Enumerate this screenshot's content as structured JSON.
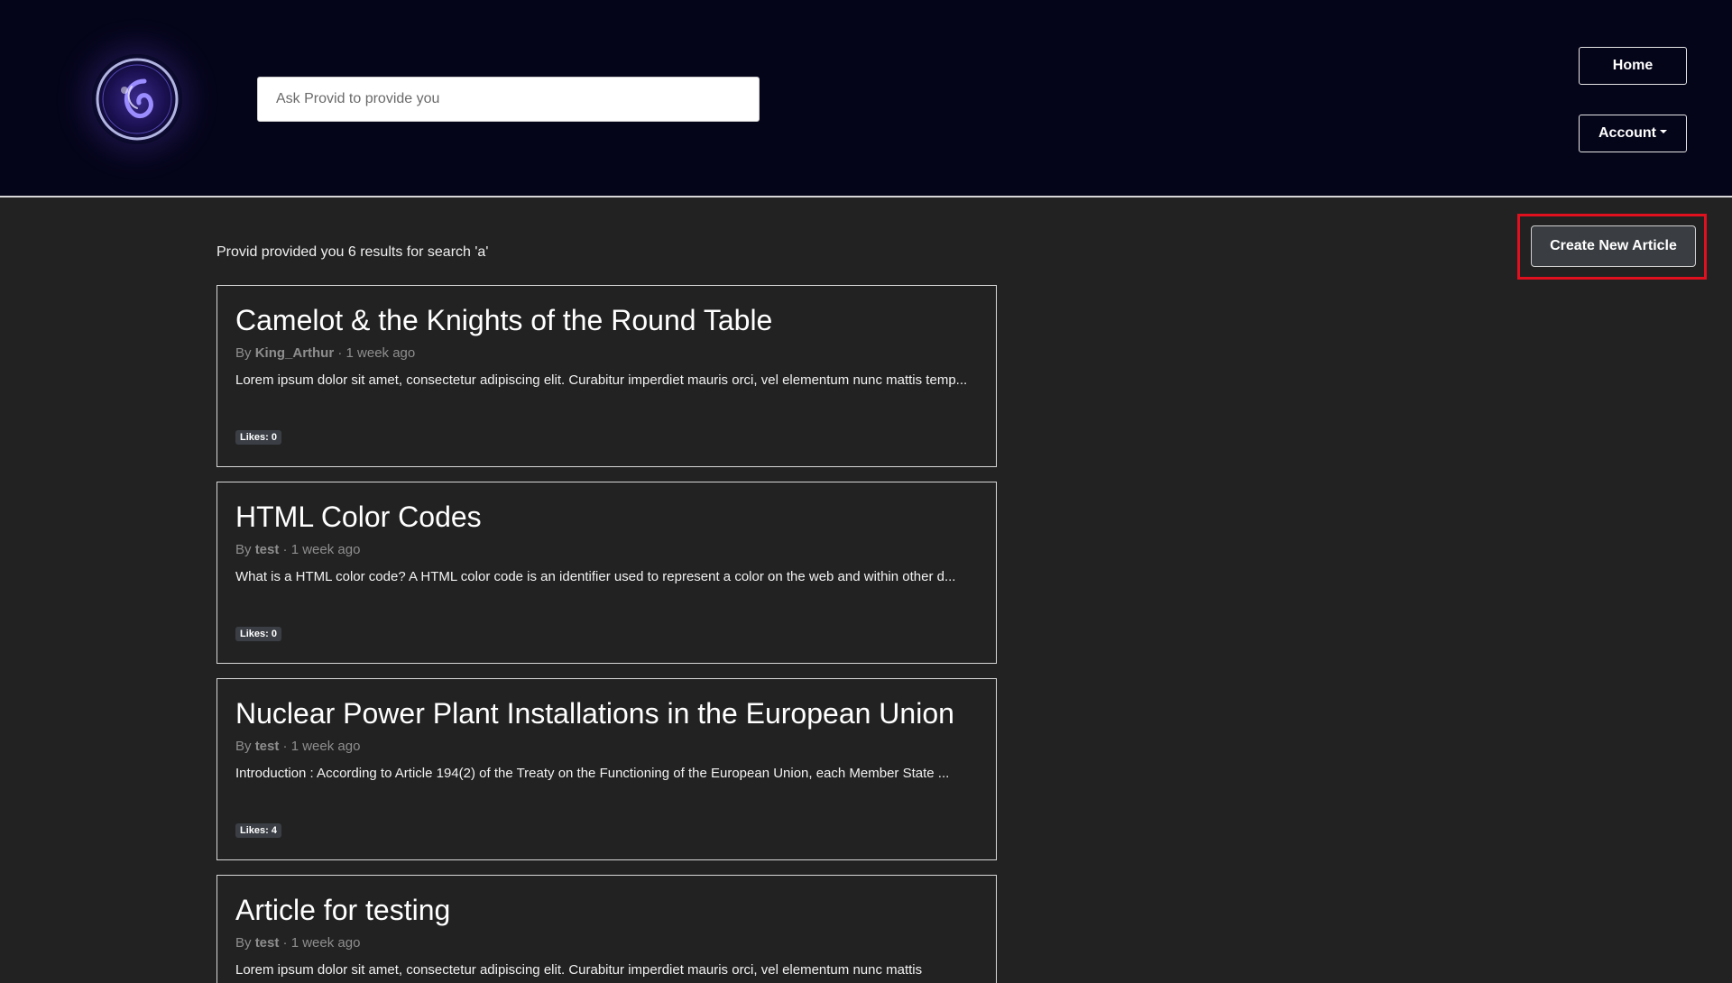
{
  "header": {
    "search_placeholder": "Ask Provid to provide you",
    "nav": {
      "home_label": "Home",
      "account_label": "Account"
    }
  },
  "toolbar": {
    "create_label": "Create New Article"
  },
  "results": {
    "summary": "Provid provided you 6 results for search 'a'"
  },
  "articles": [
    {
      "title": "Camelot & the Knights of the Round Table",
      "by": "By ",
      "author": "King_Arthur",
      "time": " · 1 week ago",
      "excerpt": "Lorem ipsum dolor sit amet, consectetur adipiscing elit. Curabitur imperdiet mauris orci, vel elementum nunc mattis temp...",
      "likes": "Likes: 0"
    },
    {
      "title": "HTML Color Codes",
      "by": "By ",
      "author": "test",
      "time": " · 1 week ago",
      "excerpt": "What is a HTML color code? A HTML color code is an identifier used to represent a color on the web and within other d...",
      "likes": "Likes: 0"
    },
    {
      "title": "Nuclear Power Plant Installations in the European Union",
      "by": "By ",
      "author": "test",
      "time": " · 1 week ago",
      "excerpt": "Introduction : According to Article 194(2) of the Treaty on the Functioning of the European Union, each Member State ...",
      "likes": "Likes: 4"
    },
    {
      "title": "Article for testing",
      "by": "By ",
      "author": "test",
      "time": " · 1 week ago",
      "excerpt": "Lorem ipsum dolor sit amet, consectetur adipiscing elit. Curabitur imperdiet mauris orci, vel elementum nunc mattis",
      "likes": ""
    }
  ],
  "colors": {
    "header_bg": "#05051a",
    "page_bg": "#222222",
    "highlight": "#e0101e"
  },
  "icons": {
    "logo": "orb-logo-icon",
    "caret": "caret-down-icon"
  }
}
